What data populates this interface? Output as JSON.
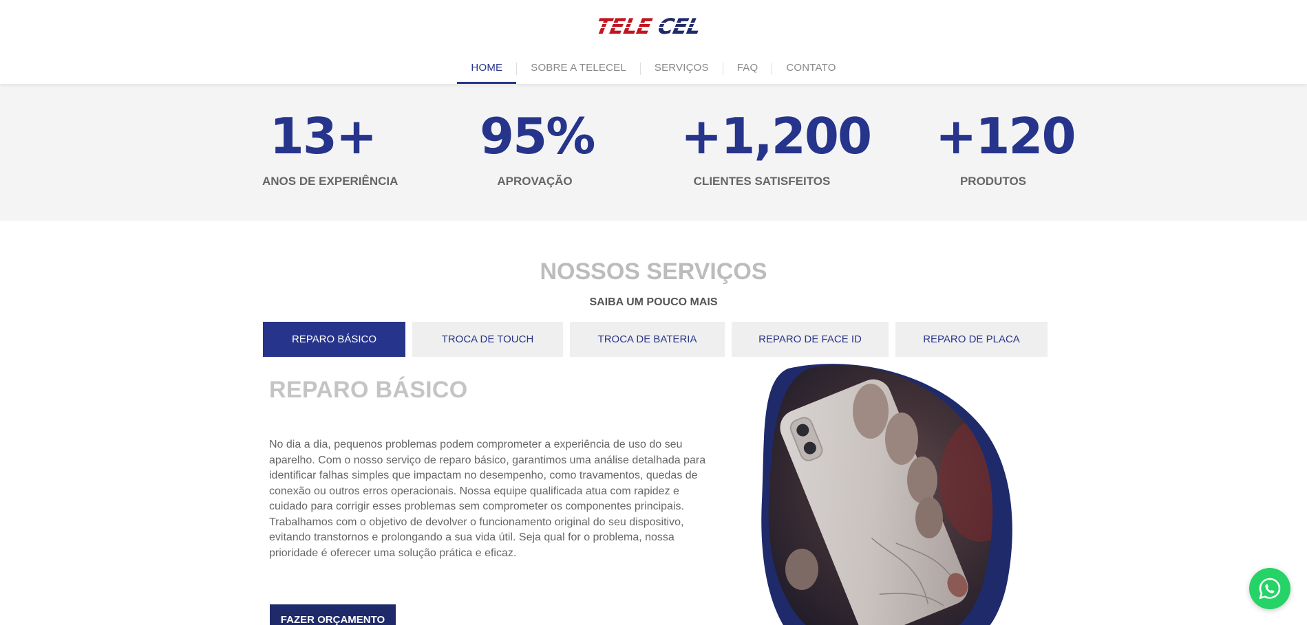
{
  "brand": {
    "logo_text": "TELECEL",
    "primary_color": "#27348b",
    "accent_color": "#c0161f"
  },
  "nav": {
    "items": [
      {
        "label": "HOME",
        "active": true
      },
      {
        "label": "SOBRE A TELECEL",
        "active": false
      },
      {
        "label": "SERVIÇOS",
        "active": false
      },
      {
        "label": "FAQ",
        "active": false
      },
      {
        "label": "CONTATO",
        "active": false
      }
    ]
  },
  "stats": [
    {
      "value": "13+",
      "label": "ANOS DE EXPERIÊNCIA"
    },
    {
      "value": "95%",
      "label": "APROVAÇÃO"
    },
    {
      "value": "+1,200",
      "label": "CLIENTES SATISFEITOS"
    },
    {
      "value": "+120",
      "label": "PRODUTOS"
    }
  ],
  "services": {
    "title_part1": "NOSSOS",
    "title_part2": "SERVIÇOS",
    "subtitle": "SAIBA UM POUCO MAIS",
    "tabs": [
      {
        "label": "REPARO BÁSICO",
        "active": true
      },
      {
        "label": "TROCA DE TOUCH",
        "active": false
      },
      {
        "label": "TROCA DE BATERIA",
        "active": false
      },
      {
        "label": "REPARO DE FACE ID",
        "active": false
      },
      {
        "label": "REPARO DE PLACA",
        "active": false
      }
    ],
    "active_title": "REPARO BÁSICO",
    "active_text": "No dia a dia, pequenos problemas podem comprometer a experiência de uso do seu aparelho. Com o nosso serviço de reparo básico, garantimos uma análise detalhada para identificar falhas simples que impactam no desempenho, como travamentos, quedas de conexão ou outros erros operacionais. Nossa equipe qualificada atua com rapidez e cuidado para corrigir esses problemas sem comprometer os componentes principais. Trabalhamos com o objetivo de devolver o funcionamento original do seu dispositivo, evitando transtornos e prolongando a sua vida útil. Seja qual for o problema, nossa prioridade é oferecer uma solução prática e eficaz.",
    "cta_label": "FAZER ORÇAMENTO"
  },
  "icons": {
    "whatsapp": "whatsapp-icon",
    "photo": "broken-phone-photo"
  }
}
